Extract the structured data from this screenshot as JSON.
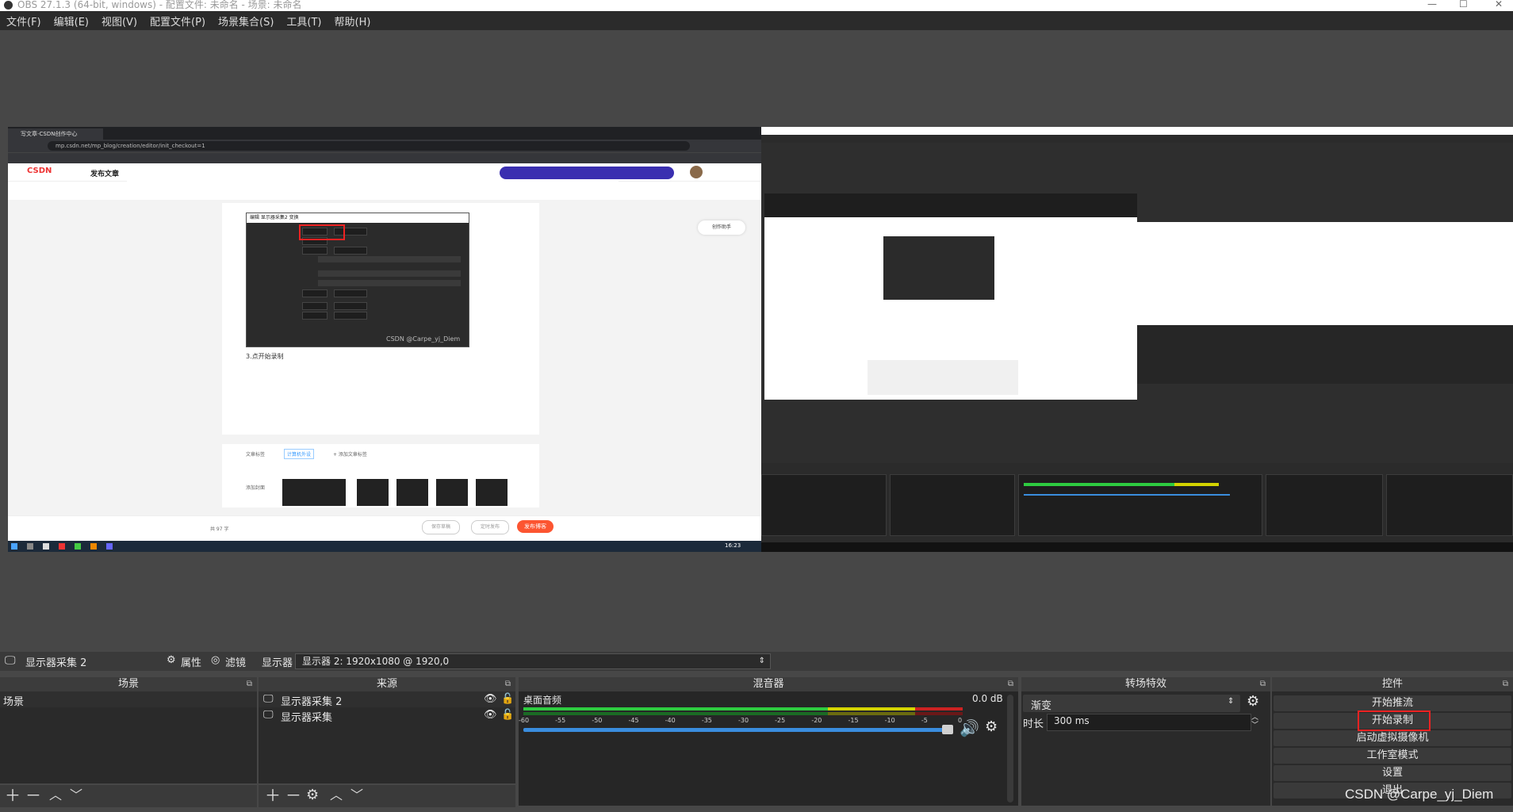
{
  "window": {
    "title": "OBS 27.1.3 (64-bit, windows) - 配置文件: 未命名 - 场景: 未命名"
  },
  "menu": [
    "文件(F)",
    "编辑(E)",
    "视图(V)",
    "配置文件(P)",
    "场景集合(S)",
    "工具(T)",
    "帮助(H)"
  ],
  "preview_left": {
    "tab_label": "写文章-CSDN创作中心",
    "url": "mp.csdn.net/mp_blog/creation/editor/init_checkout=1",
    "logo": "CSDN",
    "page_title": "发布文章",
    "dialog_title": "编辑 显示器采集2 变换",
    "caption_text": "3.点开始录制",
    "watermark": "CSDN @Carpe_yj_Diem",
    "assistant": "创作助手",
    "publish_label": "发布博客",
    "save_draft": "保存草稿",
    "schedule": "定时发布",
    "article_tag_label": "文章标签",
    "tag": "计算机外设",
    "add_tag": "+ 添加文章标签",
    "cover_label": "添加封面",
    "word_count": "共 97 字",
    "time": "16:23"
  },
  "source_toolbar": {
    "current_source": "显示器采集 2",
    "properties": "属性",
    "filters": "滤镜",
    "display_label": "显示器",
    "display_value": "显示器 2: 1920x1080 @ 1920,0"
  },
  "docks": {
    "scenes": {
      "title": "场景",
      "items": [
        "场景"
      ]
    },
    "sources": {
      "title": "来源",
      "items": [
        "显示器采集 2",
        "显示器采集"
      ]
    },
    "mixer": {
      "title": "混音器",
      "channel": "桌面音频",
      "level": "0.0 dB",
      "ticks": [
        "-60",
        "-55",
        "-50",
        "-45",
        "-40",
        "-35",
        "-30",
        "-25",
        "-20",
        "-15",
        "-10",
        "-5",
        "0"
      ]
    },
    "transitions": {
      "title": "转场特效",
      "type": "渐变",
      "duration_label": "时长",
      "duration": "300 ms"
    },
    "controls": {
      "title": "控件",
      "buttons": [
        "开始推流",
        "开始录制",
        "启动虚拟摄像机",
        "工作室模式",
        "设置",
        "退出"
      ]
    }
  },
  "watermark": "CSDN @Carpe_yj_Diem",
  "colors": {
    "highlight_red": "#e22222",
    "meter_green": "#2ecc40",
    "meter_yellow": "#d4d400",
    "meter_red": "#cc2222",
    "volume_blue": "#3a8dde"
  }
}
